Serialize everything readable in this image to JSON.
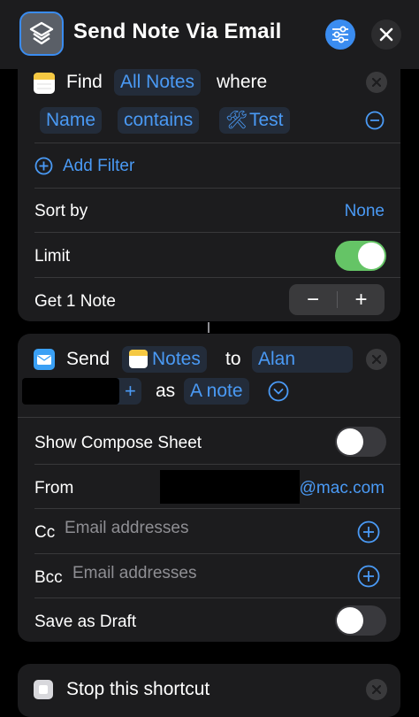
{
  "header": {
    "title": "Send Note Via Email",
    "app_icon": "shortcuts-layers-icon",
    "settings_icon": "sliders-icon",
    "close_icon": "close-icon"
  },
  "find_action": {
    "icon": "notes-app-icon",
    "verb": "Find",
    "entity": "All Notes",
    "where": "where",
    "filter": {
      "field": "Name",
      "operator": "contains",
      "value_icon": "hammer-wrench-icon",
      "value": "Test"
    },
    "add_filter": "Add Filter",
    "sort_by_label": "Sort by",
    "sort_by_value": "None",
    "limit_label": "Limit",
    "limit_enabled": true,
    "get_label": "Get 1 Note",
    "stepper_minus": "−",
    "stepper_plus": "+"
  },
  "send_action": {
    "icon": "mail-icon",
    "verb": "Send",
    "content_icon": "notes-app-icon",
    "content": "Notes",
    "to": "to",
    "recipient": "Alan",
    "plus": "+",
    "as": "as",
    "format": "A note",
    "show_compose_label": "Show Compose Sheet",
    "show_compose_enabled": false,
    "from_label": "From",
    "from_value": "@mac.com",
    "cc_label": "Cc",
    "cc_placeholder": "Email addresses",
    "bcc_label": "Bcc",
    "bcc_placeholder": "Email addresses",
    "save_draft_label": "Save as Draft",
    "save_draft_enabled": false
  },
  "stop_action": {
    "icon": "stop-icon",
    "label": "Stop this shortcut"
  },
  "colors": {
    "accent": "#4a9af5",
    "toggle_on": "#65c466",
    "card_bg": "#1c1c1e",
    "pill_bg": "#232c3a"
  }
}
